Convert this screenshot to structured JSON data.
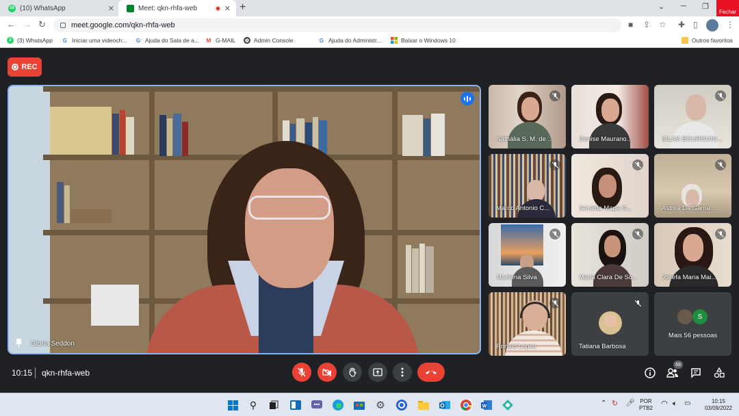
{
  "browser": {
    "tabs": [
      {
        "title": "(10) WhatsApp",
        "badge": "10",
        "active": false
      },
      {
        "title": "Meet: qkn-rhfa-web",
        "active": true
      }
    ],
    "close_tooltip": "Fechar",
    "url": "meet.google.com/qkn-rhfa-web",
    "bookmarks": [
      {
        "label": "(3) WhatsApp",
        "icon": "whatsapp-icon",
        "badge": "3"
      },
      {
        "label": "Iniciar uma videoch...",
        "icon": "google-icon"
      },
      {
        "label": "Ajuda do Sala de a...",
        "icon": "google-icon"
      },
      {
        "label": "G-MAIL",
        "icon": "gmail-icon"
      },
      {
        "label": "Admin Console",
        "icon": "globe-icon"
      },
      {
        "label": "Ajuda do Administr...",
        "icon": "google-icon"
      },
      {
        "label": "Baixar o Windows 10",
        "icon": "windows-icon"
      }
    ],
    "other_favorites": "Outros favoritos"
  },
  "meet": {
    "rec_label": "REC",
    "main_speaker": "Gloria Seddon",
    "participants": [
      {
        "name": "Nathália S. M. de ...",
        "muted": true
      },
      {
        "name": "Denise Maurano...",
        "muted": false
      },
      {
        "name": "SILAS BOURGUIG...",
        "muted": true
      },
      {
        "name": "Marco Antonio C...",
        "muted": true
      },
      {
        "name": "Geralda Mapa G...",
        "muted": true
      },
      {
        "name": "Astrea Da Gama ...",
        "muted": true
      },
      {
        "name": "Marilena Silva",
        "muted": true
      },
      {
        "name": "Maria Clara De So...",
        "muted": true
      },
      {
        "name": "Josefa Maria Mai...",
        "muted": true
      },
      {
        "name": "Ronald Lopes",
        "muted": true
      },
      {
        "name": "Tatiana Barbosa",
        "muted": true
      }
    ],
    "more_people": "Mais 56 pessoas",
    "more_avatar_letter": "S",
    "time": "10:15",
    "meeting_code": "qkn-rhfa-web",
    "participant_count": "69"
  },
  "taskbar": {
    "language": "POR",
    "keyboard": "PTB2",
    "time": "10:15",
    "date": "03/09/2022"
  },
  "colors": {
    "meet_bg": "#202124",
    "red": "#ea4335",
    "accent_blue": "#8ab4f8"
  }
}
